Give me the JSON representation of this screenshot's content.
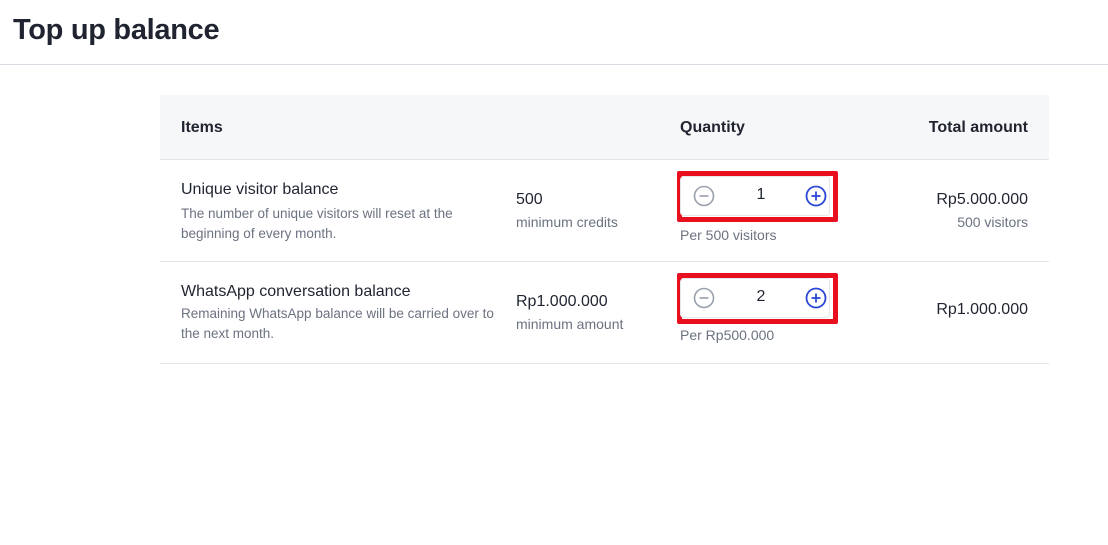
{
  "page": {
    "title": "Top up balance"
  },
  "table": {
    "headers": {
      "items": "Items",
      "quantity": "Quantity",
      "total": "Total amount"
    },
    "rows": [
      {
        "name": "Unique visitor balance",
        "description": "The number of unique visitors will reset at the beginning of every month.",
        "min_value": "500",
        "min_label": "minimum credits",
        "quantity": "1",
        "per_label": "Per 500 visitors",
        "total": "Rp5.000.000",
        "total_sub": "500 visitors"
      },
      {
        "name": "WhatsApp conversation balance",
        "description": "Remaining WhatsApp balance will be carried over to the next month.",
        "min_value": "Rp1.000.000",
        "min_label": "minimum amount",
        "quantity": "2",
        "per_label": "Per Rp500.000",
        "total": "Rp1.000.000",
        "total_sub": ""
      }
    ]
  },
  "icons": {
    "decrement": "minus-circle-icon",
    "increment": "plus-circle-icon"
  },
  "colors": {
    "highlight": "#e8101f",
    "plus_accent": "#2b47d6",
    "minus_gray": "#9aa1ab"
  }
}
